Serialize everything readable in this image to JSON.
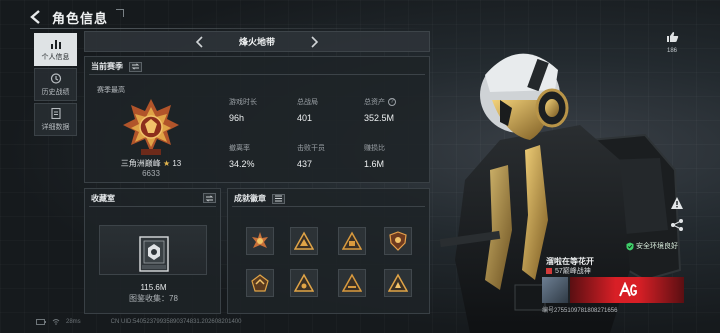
{
  "header": {
    "title": "角色信息"
  },
  "sidebar": {
    "items": [
      {
        "label": "个人信息",
        "active": true
      },
      {
        "label": "历史战绩",
        "active": false
      },
      {
        "label": "详细数据",
        "active": false
      }
    ]
  },
  "map": {
    "name": "烽火地带"
  },
  "season": {
    "header": "当前赛季",
    "best_label": "赛季最高",
    "rank_name": "三角洲巅峰",
    "rank_level": "13",
    "rank_points": "6633",
    "stats": [
      {
        "label": "游戏时长",
        "value": "96h"
      },
      {
        "label": "总战局",
        "value": "401"
      },
      {
        "label": "总资产",
        "value": "352.5M"
      },
      {
        "label": "撤离率",
        "value": "34.2%"
      },
      {
        "label": "击败干员",
        "value": "437"
      },
      {
        "label": "赚损比",
        "value": "1.6M"
      }
    ]
  },
  "collection": {
    "header": "收藏室",
    "value": "115.6M",
    "count_text": "图鉴收集：78"
  },
  "achievements": {
    "header": "成就徽章"
  },
  "footer": {
    "signal": "28ms",
    "uid": "CN UID:54052379935890374831.202608201400"
  },
  "likes": {
    "count": "186"
  },
  "player": {
    "safety": "安全环境良好",
    "name": "溜啦在等花开",
    "tag": "57巅峰战神",
    "id": "编号2755109781808271656"
  },
  "colors": {
    "accent_gold": "#e3b64e",
    "banner_red": "#d81f26",
    "safe_green": "#3fcf6a"
  }
}
